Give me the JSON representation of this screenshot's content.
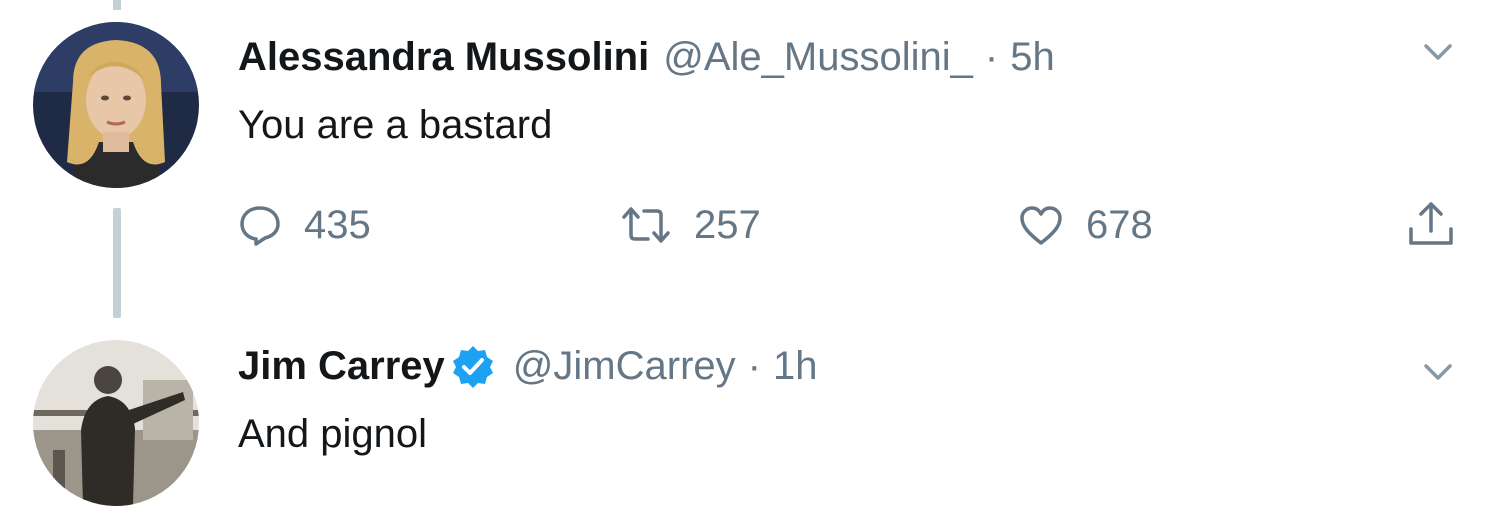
{
  "tweets": [
    {
      "name": "Alessandra Mussolini",
      "handle": "@Ale_Mussolini_",
      "separator": "·",
      "time": "5h",
      "text": "You are a bastard",
      "verified": false,
      "replies": "435",
      "retweets": "257",
      "likes": "678"
    },
    {
      "name": "Jim Carrey",
      "handle": "@JimCarrey",
      "separator": "·",
      "time": "1h",
      "text": "And pignol",
      "verified": true
    }
  ],
  "colors": {
    "text": "#14171a",
    "secondary": "#657786",
    "verified": "#1da1f2",
    "thread_line": "#c4cfd6"
  },
  "icons": {
    "reply": "speech-bubble-icon",
    "retweet": "retweet-arrows-icon",
    "like": "heart-icon",
    "share": "share-upload-icon",
    "caret": "chevron-down-icon",
    "verified": "verified-badge-icon"
  }
}
